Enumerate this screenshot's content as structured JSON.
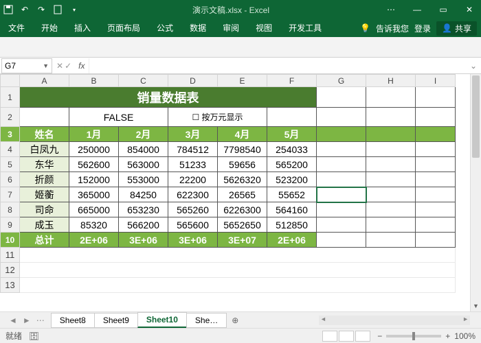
{
  "titlebar": {
    "title": "演示文稿.xlsx - Excel"
  },
  "ribbon": {
    "tabs": [
      "文件",
      "开始",
      "插入",
      "页面布局",
      "公式",
      "数据",
      "审阅",
      "视图",
      "开发工具"
    ],
    "tell_me": "告诉我您",
    "login": "登录",
    "share": "共享"
  },
  "namebox": {
    "ref": "G7",
    "formula": ""
  },
  "columns": [
    "A",
    "B",
    "C",
    "D",
    "E",
    "F",
    "G",
    "H",
    "I"
  ],
  "row_numbers": [
    1,
    2,
    3,
    4,
    5,
    6,
    7,
    8,
    9,
    10,
    11,
    12,
    13
  ],
  "sheet": {
    "title": "销量数据表",
    "false_label": "FALSE",
    "checkbox_label": "按万元显示",
    "headers": [
      "姓名",
      "1月",
      "2月",
      "3月",
      "4月",
      "5月"
    ],
    "rows": [
      {
        "name": "白凤九",
        "v": [
          "250000",
          "854000",
          "784512",
          "7798540",
          "254033"
        ]
      },
      {
        "name": "东华",
        "v": [
          "562600",
          "563000",
          "51233",
          "59656",
          "565200"
        ]
      },
      {
        "name": "折颜",
        "v": [
          "152000",
          "553000",
          "22200",
          "5626320",
          "523200"
        ]
      },
      {
        "name": "姬蘅",
        "v": [
          "365000",
          "84250",
          "622300",
          "26565",
          "55652"
        ]
      },
      {
        "name": "司命",
        "v": [
          "665000",
          "653230",
          "565260",
          "6226300",
          "564160"
        ]
      },
      {
        "name": "成玉",
        "v": [
          "85320",
          "566200",
          "565600",
          "5652650",
          "512850"
        ]
      }
    ],
    "total": {
      "label": "总计",
      "v": [
        "2E+06",
        "3E+06",
        "3E+06",
        "3E+07",
        "2E+06"
      ]
    }
  },
  "tabs": {
    "items": [
      "Sheet8",
      "Sheet9",
      "Sheet10",
      "She…"
    ],
    "active": 2
  },
  "status": {
    "ready": "就绪",
    "calc": "",
    "zoom": "100%"
  }
}
